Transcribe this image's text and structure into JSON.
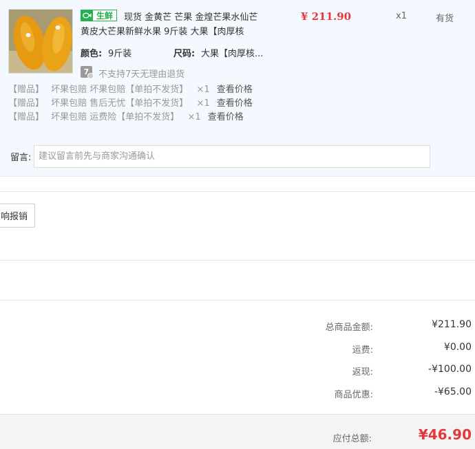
{
  "product": {
    "fresh_tag": "生鲜",
    "title_line1": "现货 金黄芒 芒果 金煌芒果水仙芒",
    "title_line2": "黄皮大芒果新鲜水果 9斤装 大果【肉厚核",
    "price": "¥ 211.90",
    "quantity": "x1",
    "stock_status": "有货",
    "color_label": "颜色:",
    "color_value": "9斤装",
    "size_label": "尺码:",
    "size_value": "大果【肉厚核...",
    "return_badge": "7",
    "return_policy": "不支持7天无理由退货"
  },
  "gifts": [
    {
      "tag": "【赠品】",
      "name": "坏果包赔 坏果包赔【单拍不发货】",
      "qty": "×1",
      "link": "查看价格"
    },
    {
      "tag": "【赠品】",
      "name": "坏果包赔 售后无忧【单拍不发货】",
      "qty": "×1",
      "link": "查看价格"
    },
    {
      "tag": "【赠品】",
      "name": "坏果包赔 运费险【单拍不发货】",
      "qty": "×1",
      "link": "查看价格"
    }
  ],
  "remark": {
    "label": "留言:",
    "placeholder": "建议留言前先与商家沟通确认"
  },
  "invoice_button": "响报销",
  "summary": [
    {
      "label": "总商品金额:",
      "value": "¥211.90"
    },
    {
      "label": "运费:",
      "value": "¥0.00"
    },
    {
      "label": "返现:",
      "value": "-¥100.00"
    },
    {
      "label": "商品优惠:",
      "value": "-¥65.00"
    }
  ],
  "total": {
    "label": "应付总额:",
    "value": "¥46.90"
  },
  "colors": {
    "price_red": "#e4393c",
    "fresh_green": "#26b04f",
    "card_bg": "#f3f9fe"
  }
}
